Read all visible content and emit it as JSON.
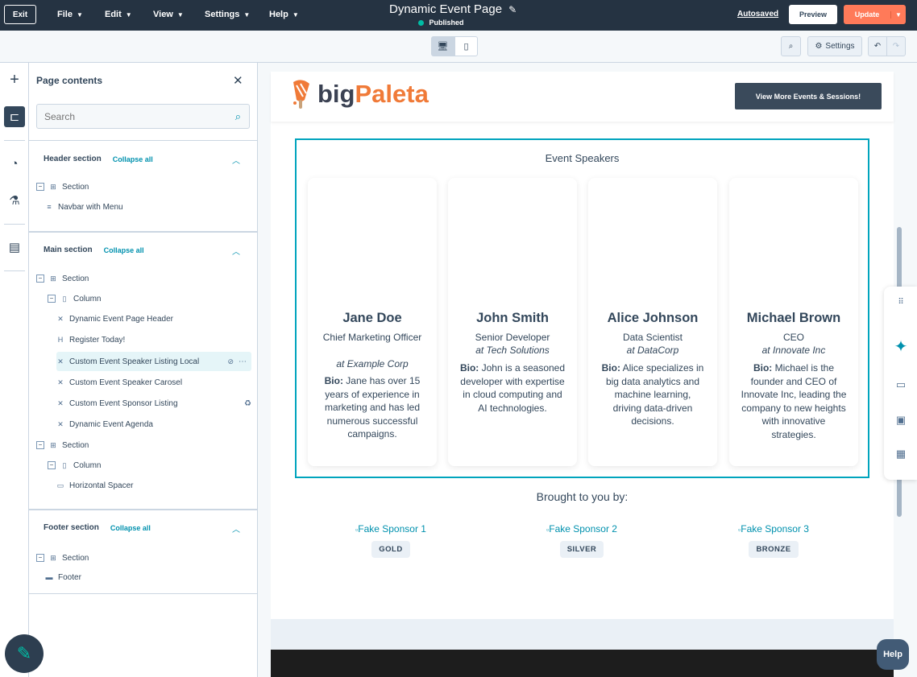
{
  "topbar": {
    "exit": "Exit",
    "menus": [
      "File",
      "Edit",
      "View",
      "Settings",
      "Help"
    ],
    "title": "Dynamic Event Page",
    "status": "Published",
    "autosaved": "Autosaved",
    "preview": "Preview",
    "update": "Update"
  },
  "toolbar": {
    "settings": "Settings"
  },
  "panel": {
    "title": "Page contents",
    "search_placeholder": "Search",
    "header_group": {
      "title": "Header section",
      "collapse": "Collapse all",
      "items": [
        "Section",
        "Navbar with Menu"
      ]
    },
    "main_group": {
      "title": "Main section",
      "collapse": "Collapse all",
      "items": [
        "Section",
        "Column",
        "Dynamic Event Page Header",
        "Register Today!",
        "Custom Event Speaker Listing Local",
        "Custom Event Speaker Carosel",
        "Custom Event Sponsor Listing",
        "Dynamic Event Agenda",
        "Section",
        "Column",
        "Horizontal Spacer"
      ]
    },
    "footer_group": {
      "title": "Footer section",
      "collapse": "Collapse all",
      "items": [
        "Section",
        "Footer"
      ]
    }
  },
  "page": {
    "logo_big": "big",
    "logo_paleta": "Paleta",
    "cta": "View More Events & Sessions!",
    "speakers_title": "Event Speakers",
    "speakers": [
      {
        "name": "Jane Doe",
        "role": "Chief Marketing Officer",
        "company": "at Example Corp",
        "bio_label": "Bio:",
        "bio": "Jane has over 15 years of experience in marketing and has led numerous successful campaigns."
      },
      {
        "name": "John Smith",
        "role": "Senior Developer",
        "company": "at Tech Solutions",
        "bio_label": "Bio:",
        "bio": "John is a seasoned developer with expertise in cloud computing and AI technologies."
      },
      {
        "name": "Alice Johnson",
        "role": "Data Scientist",
        "company": "at DataCorp",
        "bio_label": "Bio:",
        "bio": "Alice specializes in big data analytics and machine learning, driving data-driven decisions."
      },
      {
        "name": "Michael Brown",
        "role": "CEO",
        "company": "at Innovate Inc",
        "bio_label": "Bio:",
        "bio": "Michael is the founder and CEO of Innovate Inc, leading the company to new heights with innovative strategies."
      }
    ],
    "sponsors_title": "Brought to you by:",
    "sponsors": [
      {
        "alt": "Fake Sponsor 1",
        "tier": "GOLD"
      },
      {
        "alt": "Fake Sponsor 2",
        "tier": "SILVER"
      },
      {
        "alt": "Fake Sponsor 3",
        "tier": "BRONZE"
      }
    ]
  },
  "help": "Help",
  "colors": {
    "accent": "#00a4bd",
    "update": "#ff7a59",
    "topbar": "#253342",
    "brand_orange": "#f07a38"
  }
}
